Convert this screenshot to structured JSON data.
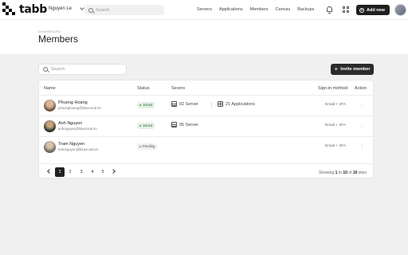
{
  "app": {
    "logo_text": "tabb",
    "user_name": "Nguyen Le"
  },
  "topbar": {
    "search_placeholder": "Search",
    "nav": [
      "Servers",
      "Applications",
      "Members",
      "Canvas",
      "Backups"
    ],
    "add_new_label": "Add new"
  },
  "header": {
    "breadcrumb": "DASHBOARD",
    "title": "Members"
  },
  "toolbar": {
    "search_placeholder": "Search",
    "invite_label": "Invite member"
  },
  "table": {
    "columns": {
      "name": "Name",
      "status": "Status",
      "servers": "Severs",
      "signin": "Sign-in method",
      "action": "Action"
    },
    "rows": [
      {
        "name": "Phuong Hoang",
        "email": "phuonghoang@bluecoral.vn",
        "status": "Joined",
        "servers": "02 Server",
        "applications": "21 Applications",
        "signin": "Email + 2FA"
      },
      {
        "name": "Anh Nguyen",
        "email": "anhnguyen@bluecoral.vn",
        "status": "Joined",
        "servers": "05 Server",
        "applications": "",
        "signin": "Email + 2FA"
      },
      {
        "name": "Tram Nguyen",
        "email": "tramnguyen@bluecoral.vn",
        "status": "Pending",
        "servers": "",
        "applications": "",
        "signin": "Email + 2FA"
      }
    ],
    "action_glyph": "⋮"
  },
  "pagination": {
    "pages": [
      "1",
      "2",
      "3",
      "4",
      "5"
    ],
    "active_page": "1",
    "showing_prefix": "Showing",
    "showing_from": "1",
    "showing_to_word": "to",
    "showing_to": "10",
    "showing_of_word": "of",
    "showing_total": "10",
    "showing_suffix": "sites"
  },
  "colors": {
    "primary_button": "#1f1f1f",
    "joined_badge": "#e3f2e6",
    "pending_badge": "#efefef",
    "page_bg": "#f0f0f1"
  }
}
